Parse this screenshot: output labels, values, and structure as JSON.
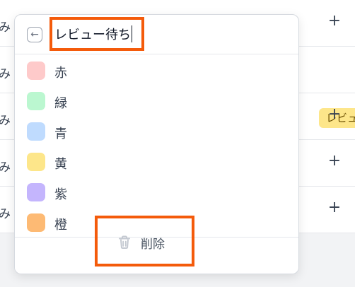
{
  "background": {
    "rows": [
      {
        "text": "み",
        "action": "+"
      },
      {
        "text": "み",
        "tag": "レビュ"
      },
      {
        "text": "み",
        "action": "+"
      },
      {
        "text": "み",
        "action": "+"
      },
      {
        "text": "み",
        "action": "+"
      }
    ]
  },
  "popover": {
    "back_icon": "arrow-left-icon",
    "search_value": "レビュー待ち",
    "items": [
      {
        "label": "赤",
        "color": "#fecaca"
      },
      {
        "label": "緑",
        "color": "#bbf7d0"
      },
      {
        "label": "青",
        "color": "#bfdbfe"
      },
      {
        "label": "黄",
        "color": "#fde68a"
      },
      {
        "label": "紫",
        "color": "#c4b5fd"
      },
      {
        "label": "橙",
        "color": "#fdba74"
      }
    ],
    "delete_label": "削除",
    "delete_icon": "trash-icon"
  },
  "colors": {
    "highlight": "#f45b0b"
  }
}
